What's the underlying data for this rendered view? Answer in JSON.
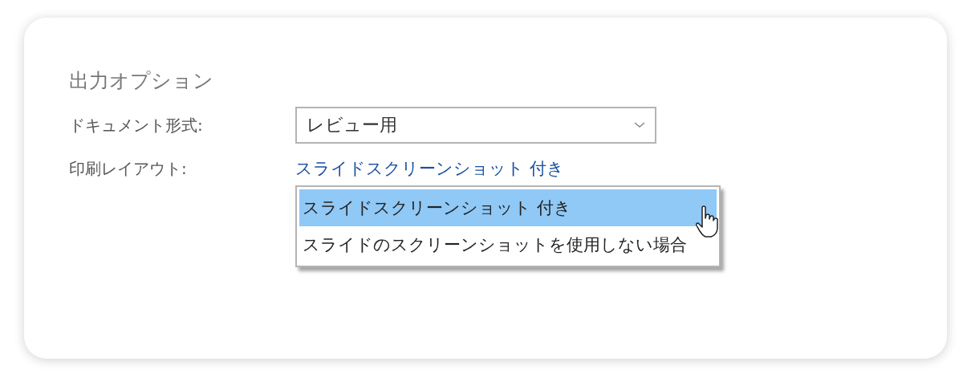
{
  "section_title": "出力オプション",
  "fields": [
    {
      "label": "ドキュメント形式:",
      "kind": "select",
      "value": "レビュー用"
    },
    {
      "label": "印刷レイアウト:",
      "kind": "link",
      "value": "スライドスクリーンショット 付き"
    }
  ],
  "dropdown": {
    "items": [
      {
        "label": "スライドスクリーンショット 付き",
        "selected": true
      },
      {
        "label": "スライドのスクリーンショットを使用しない場合",
        "selected": false
      }
    ]
  }
}
